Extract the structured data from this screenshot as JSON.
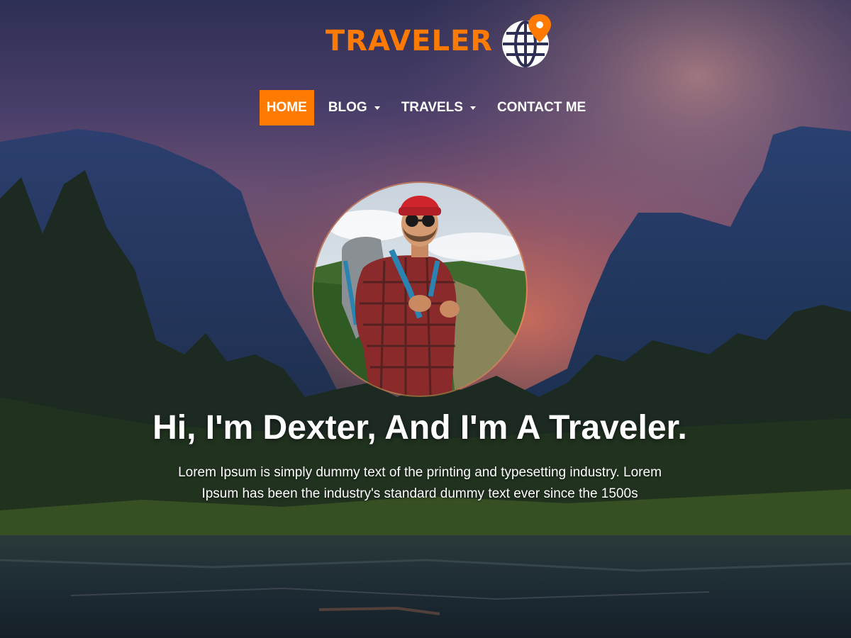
{
  "brand": {
    "name": "TRAVELER",
    "logo_icon": "globe-location-pin-icon",
    "accent_color": "#ff7a00"
  },
  "nav": {
    "items": [
      {
        "label": "HOME",
        "active": true,
        "has_dropdown": false
      },
      {
        "label": "BLOG",
        "active": false,
        "has_dropdown": true
      },
      {
        "label": "TRAVELS",
        "active": false,
        "has_dropdown": true
      },
      {
        "label": "CONTACT ME",
        "active": false,
        "has_dropdown": false
      }
    ]
  },
  "hero": {
    "headline": "Hi, I'm Dexter, And I'm A Traveler.",
    "subtext": "Lorem Ipsum is simply dummy text of the printing and typesetting industry. Lorem Ipsum has been the industry's standard dummy text ever since the 1500s"
  }
}
